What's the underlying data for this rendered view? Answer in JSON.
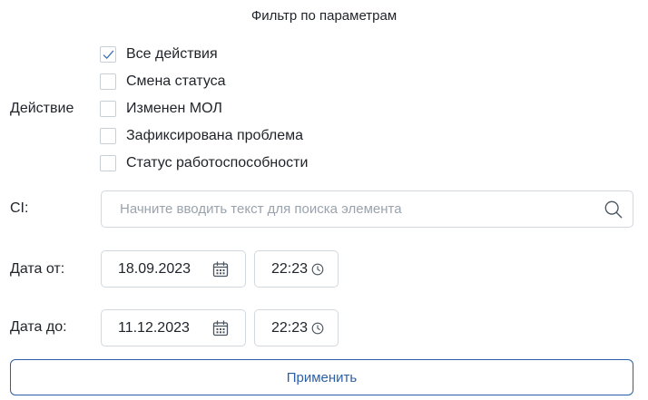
{
  "filter": {
    "title": "Фильтр по параметрам",
    "action_label": "Действие",
    "options": [
      {
        "label": "Все действия",
        "checked": true
      },
      {
        "label": "Смена статуса",
        "checked": false
      },
      {
        "label": "Изменен МОЛ",
        "checked": false
      },
      {
        "label": "Зафиксирована проблема",
        "checked": false
      },
      {
        "label": "Статус работоспособности",
        "checked": false
      }
    ],
    "ci": {
      "label": "CI:",
      "placeholder": "Начните вводить текст для поиска элемента",
      "icon": "search-icon"
    },
    "date_from": {
      "label": "Дата от:",
      "date": "18.09.2023",
      "time": "22:23"
    },
    "date_to": {
      "label": "Дата до:",
      "date": "11.12.2023",
      "time": "22:23"
    },
    "apply_label": "Применить",
    "colors": {
      "accent": "#2a5fa8",
      "border": "#d3d8de",
      "check": "#3a6fb5",
      "icon": "#4a5560",
      "placeholder": "#9aa3ad"
    }
  }
}
